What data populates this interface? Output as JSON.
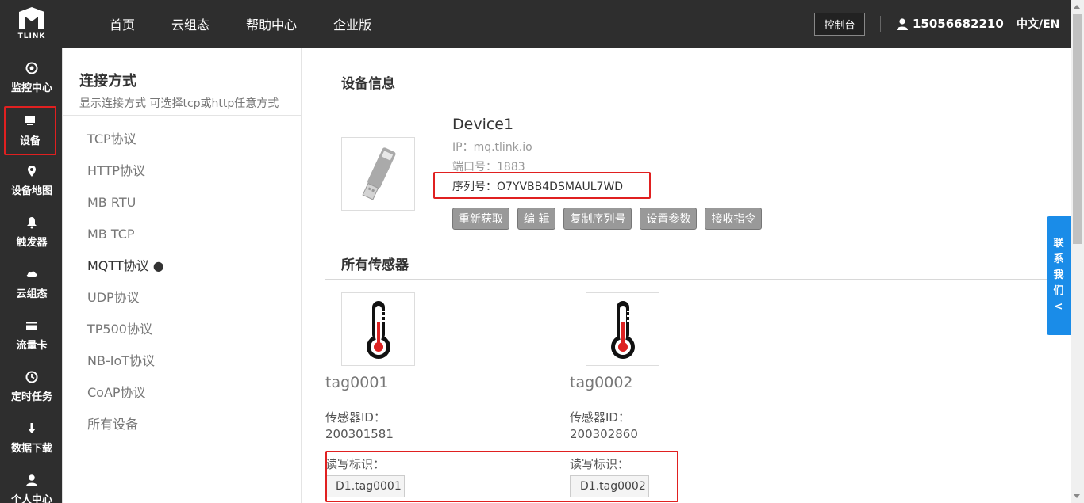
{
  "brand": {
    "logo_text": "TLINK"
  },
  "nav": {
    "items": [
      "首页",
      "云组态",
      "帮助中心",
      "企业版"
    ]
  },
  "header": {
    "console": "控制台",
    "phone": "15056682210",
    "lang": "中文/EN"
  },
  "sidebar": {
    "items": [
      {
        "label": "监控中心",
        "icon": "monitor-icon"
      },
      {
        "label": "设备",
        "icon": "device-icon"
      },
      {
        "label": "设备地图",
        "icon": "map-pin-icon"
      },
      {
        "label": "触发器",
        "icon": "bell-icon"
      },
      {
        "label": "云组态",
        "icon": "cloud-icon"
      },
      {
        "label": "流量卡",
        "icon": "card-icon"
      },
      {
        "label": "定时任务",
        "icon": "clock-icon"
      },
      {
        "label": "数据下载",
        "icon": "download-icon"
      },
      {
        "label": "个人中心",
        "icon": "user-icon"
      }
    ]
  },
  "submenu": {
    "title": "连接方式",
    "subtitle": "显示连接方式 可选择tcp或http任意方式",
    "items": [
      "TCP协议",
      "HTTP协议",
      "MB RTU",
      "MB TCP",
      "MQTT协议 ●",
      "UDP协议",
      "TP500协议",
      "NB-IoT协议",
      "CoAP协议",
      "所有设备"
    ]
  },
  "device": {
    "section_title": "设备信息",
    "name": "Device1",
    "ip": "IP：mq.tlink.io",
    "port": "端口号：1883",
    "serial": "序列号：O7YVBB4DSMAUL7WD",
    "buttons": [
      "重新获取",
      "编 辑",
      "复制序列号",
      "设置参数",
      "接收指令"
    ]
  },
  "sensors": {
    "section_title": "所有传感器",
    "id_label": "传感器ID：",
    "rw_label": "读写标识：",
    "items": [
      {
        "tag": "tag0001",
        "id": "200301581",
        "rw": "D1.tag0001"
      },
      {
        "tag": "tag0002",
        "id": "200302860",
        "rw": "D1.tag0002"
      }
    ]
  },
  "contact": {
    "lines": [
      "联",
      "系",
      "我",
      "们",
      "<"
    ]
  },
  "colors": {
    "header_bg": "#2e2e2e",
    "highlight": "#e02020",
    "contact_bg": "#1a8ce8",
    "button_bg": "#999999"
  }
}
